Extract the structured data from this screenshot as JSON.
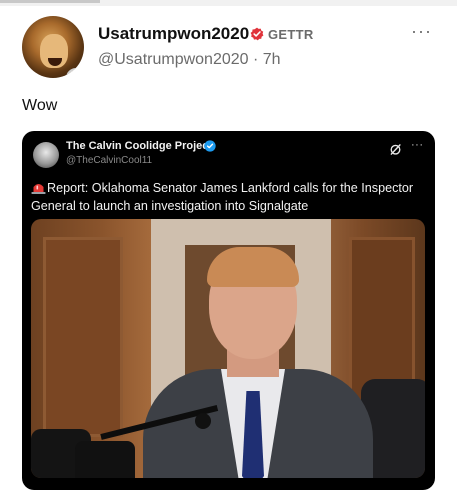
{
  "post": {
    "author": {
      "display_name": "Usatrumpwon2020",
      "platform_label": "GETTR",
      "handle": "@Usatrumpwon2020",
      "separator": "·",
      "time_ago": "7h"
    },
    "more_label": "···",
    "text": "Wow"
  },
  "embedded_post": {
    "author": {
      "display_name": "The Calvin Coolidge Project",
      "handle": "@TheCalvinCool11"
    },
    "more_label": "···",
    "text": "Report: Oklahoma Senator James Lankford calls for the Inspector General to launch an investigation into Signalgate",
    "icons": [
      "siren-icon",
      "grok-icon",
      "verified-icon"
    ]
  },
  "colors": {
    "verified_badge": "#e0333b",
    "embed_verified": "#1d9bf0",
    "embed_background": "#000000",
    "muted_text": "#6b6b6b"
  }
}
